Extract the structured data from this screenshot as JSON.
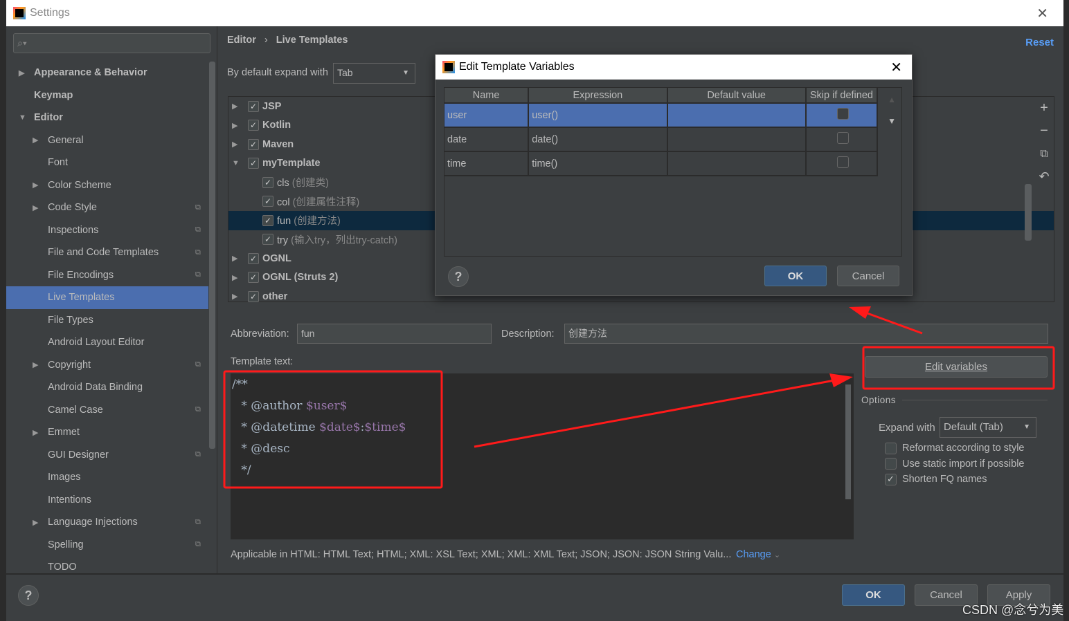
{
  "window": {
    "title": "Settings"
  },
  "sidebar": {
    "items": [
      {
        "label": "Appearance & Behavior",
        "bold": true,
        "arrow": "right",
        "indent": 0
      },
      {
        "label": "Keymap",
        "bold": true,
        "arrow": "",
        "indent": 0
      },
      {
        "label": "Editor",
        "bold": true,
        "arrow": "down",
        "indent": 0
      },
      {
        "label": "General",
        "arrow": "right",
        "indent": 1
      },
      {
        "label": "Font",
        "indent": 1
      },
      {
        "label": "Color Scheme",
        "arrow": "right",
        "indent": 1
      },
      {
        "label": "Code Style",
        "arrow": "right",
        "indent": 1,
        "copy": true
      },
      {
        "label": "Inspections",
        "indent": 1,
        "copy": true
      },
      {
        "label": "File and Code Templates",
        "indent": 1,
        "copy": true
      },
      {
        "label": "File Encodings",
        "indent": 1,
        "copy": true
      },
      {
        "label": "Live Templates",
        "indent": 1,
        "selected": true
      },
      {
        "label": "File Types",
        "indent": 1
      },
      {
        "label": "Android Layout Editor",
        "indent": 1
      },
      {
        "label": "Copyright",
        "arrow": "right",
        "indent": 1,
        "copy": true
      },
      {
        "label": "Android Data Binding",
        "indent": 1
      },
      {
        "label": "Camel Case",
        "indent": 1,
        "copy": true
      },
      {
        "label": "Emmet",
        "arrow": "right",
        "indent": 1
      },
      {
        "label": "GUI Designer",
        "indent": 1,
        "copy": true
      },
      {
        "label": "Images",
        "indent": 1
      },
      {
        "label": "Intentions",
        "indent": 1
      },
      {
        "label": "Language Injections",
        "arrow": "right",
        "indent": 1,
        "copy": true
      },
      {
        "label": "Spelling",
        "indent": 1,
        "copy": true
      },
      {
        "label": "TODO",
        "indent": 1
      }
    ]
  },
  "breadcrumb": {
    "parent": "Editor",
    "sep": "›",
    "current": "Live Templates"
  },
  "reset": "Reset",
  "expand_default": {
    "label": "By default expand with",
    "value": "Tab"
  },
  "templates": [
    {
      "name": "JSP",
      "group": true,
      "arrow": "right",
      "checked": true
    },
    {
      "name": "Kotlin",
      "group": true,
      "arrow": "right",
      "checked": true
    },
    {
      "name": "Maven",
      "group": true,
      "arrow": "right",
      "checked": true
    },
    {
      "name": "myTemplate",
      "group": true,
      "arrow": "down",
      "checked": true
    },
    {
      "name": "cls",
      "desc": "(创建类)",
      "checked": true
    },
    {
      "name": "col",
      "desc": "(创建属性注释)",
      "checked": true
    },
    {
      "name": "fun",
      "desc": "(创建方法)",
      "checked": true,
      "selected": true
    },
    {
      "name": "try",
      "desc": "(输入try，列出try-catch)",
      "checked": true
    },
    {
      "name": "OGNL",
      "group": true,
      "arrow": "right",
      "checked": true
    },
    {
      "name": "OGNL (Struts 2)",
      "group": true,
      "arrow": "right",
      "checked": true
    },
    {
      "name": "other",
      "group": true,
      "arrow": "right",
      "checked": true
    }
  ],
  "toolbar_icons": [
    "plus-icon",
    "minus-icon",
    "copy-icon",
    "undo-icon"
  ],
  "abbreviation": {
    "label": "Abbreviation:",
    "value": "fun"
  },
  "description": {
    "label": "Description:",
    "value": "创建方法"
  },
  "template_text": {
    "label": "Template text:",
    "lines": [
      [
        {
          "t": "/**"
        }
      ],
      [
        {
          "t": " * @author "
        },
        {
          "t": "$user$",
          "v": true
        }
      ],
      [
        {
          "t": " * @datetime "
        },
        {
          "t": "$date$",
          "v": true
        },
        {
          "t": ":"
        },
        {
          "t": "$time$",
          "v": true
        }
      ],
      [
        {
          "t": " * @desc"
        }
      ],
      [
        {
          "t": " */"
        }
      ]
    ]
  },
  "edit_variables": "Edit variables",
  "options": {
    "title": "Options",
    "expand_label": "Expand with",
    "expand_value": "Default (Tab)",
    "checks": [
      {
        "label": "Reformat according to style",
        "checked": false
      },
      {
        "label": "Use static import if possible",
        "checked": false
      },
      {
        "label": "Shorten FQ names",
        "checked": true
      }
    ]
  },
  "applicable": {
    "text": "Applicable in HTML: HTML Text; HTML; XML: XSL Text; XML; XML: XML Text; JSON; JSON: JSON String Valu...",
    "change": "Change"
  },
  "footer": {
    "ok": "OK",
    "cancel": "Cancel",
    "apply": "Apply"
  },
  "dialog": {
    "title": "Edit Template Variables",
    "columns": [
      "Name",
      "Expression",
      "Default value",
      "Skip if defined"
    ],
    "rows": [
      {
        "name": "user",
        "expression": "user()",
        "default": "",
        "skip": false,
        "selected": true
      },
      {
        "name": "date",
        "expression": "date()",
        "default": "",
        "skip": false
      },
      {
        "name": "time",
        "expression": "time()",
        "default": "",
        "skip": false
      }
    ],
    "ok": "OK",
    "cancel": "Cancel"
  },
  "watermark": "CSDN @念兮为美",
  "colors": {
    "accent": "#4b6eaf",
    "annotation": "#ff1a1a",
    "link": "#589df6"
  }
}
